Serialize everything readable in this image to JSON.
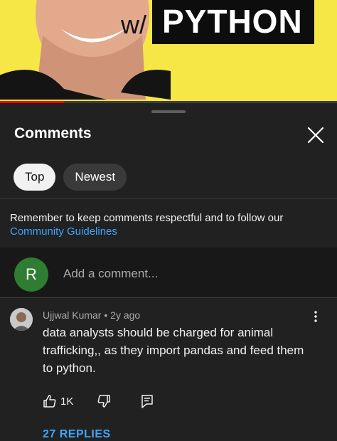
{
  "video": {
    "prefix": "w/",
    "title_word": "PYTHON",
    "progress_fraction": 0.19,
    "colors": {
      "background": "#f6e646",
      "badge": "#0d0d0d",
      "progress": "#ff0000"
    }
  },
  "comments_panel": {
    "title": "Comments",
    "close_icon": "close-icon",
    "tabs": [
      {
        "label": "Top",
        "active": true
      },
      {
        "label": "Newest",
        "active": false
      }
    ],
    "notice": {
      "text": "Remember to keep comments respectful and to follow our",
      "link": "Community Guidelines"
    },
    "add_comment": {
      "avatar_initial": "R",
      "placeholder": "Add a comment..."
    },
    "comment": {
      "author": "Ujjwal Kumar",
      "time": "2y ago",
      "text": "data analysts should be charged for animal trafficking,, as they import pandas and feed them to python.",
      "likes": "1K",
      "replies": "27 REPLIES"
    }
  }
}
